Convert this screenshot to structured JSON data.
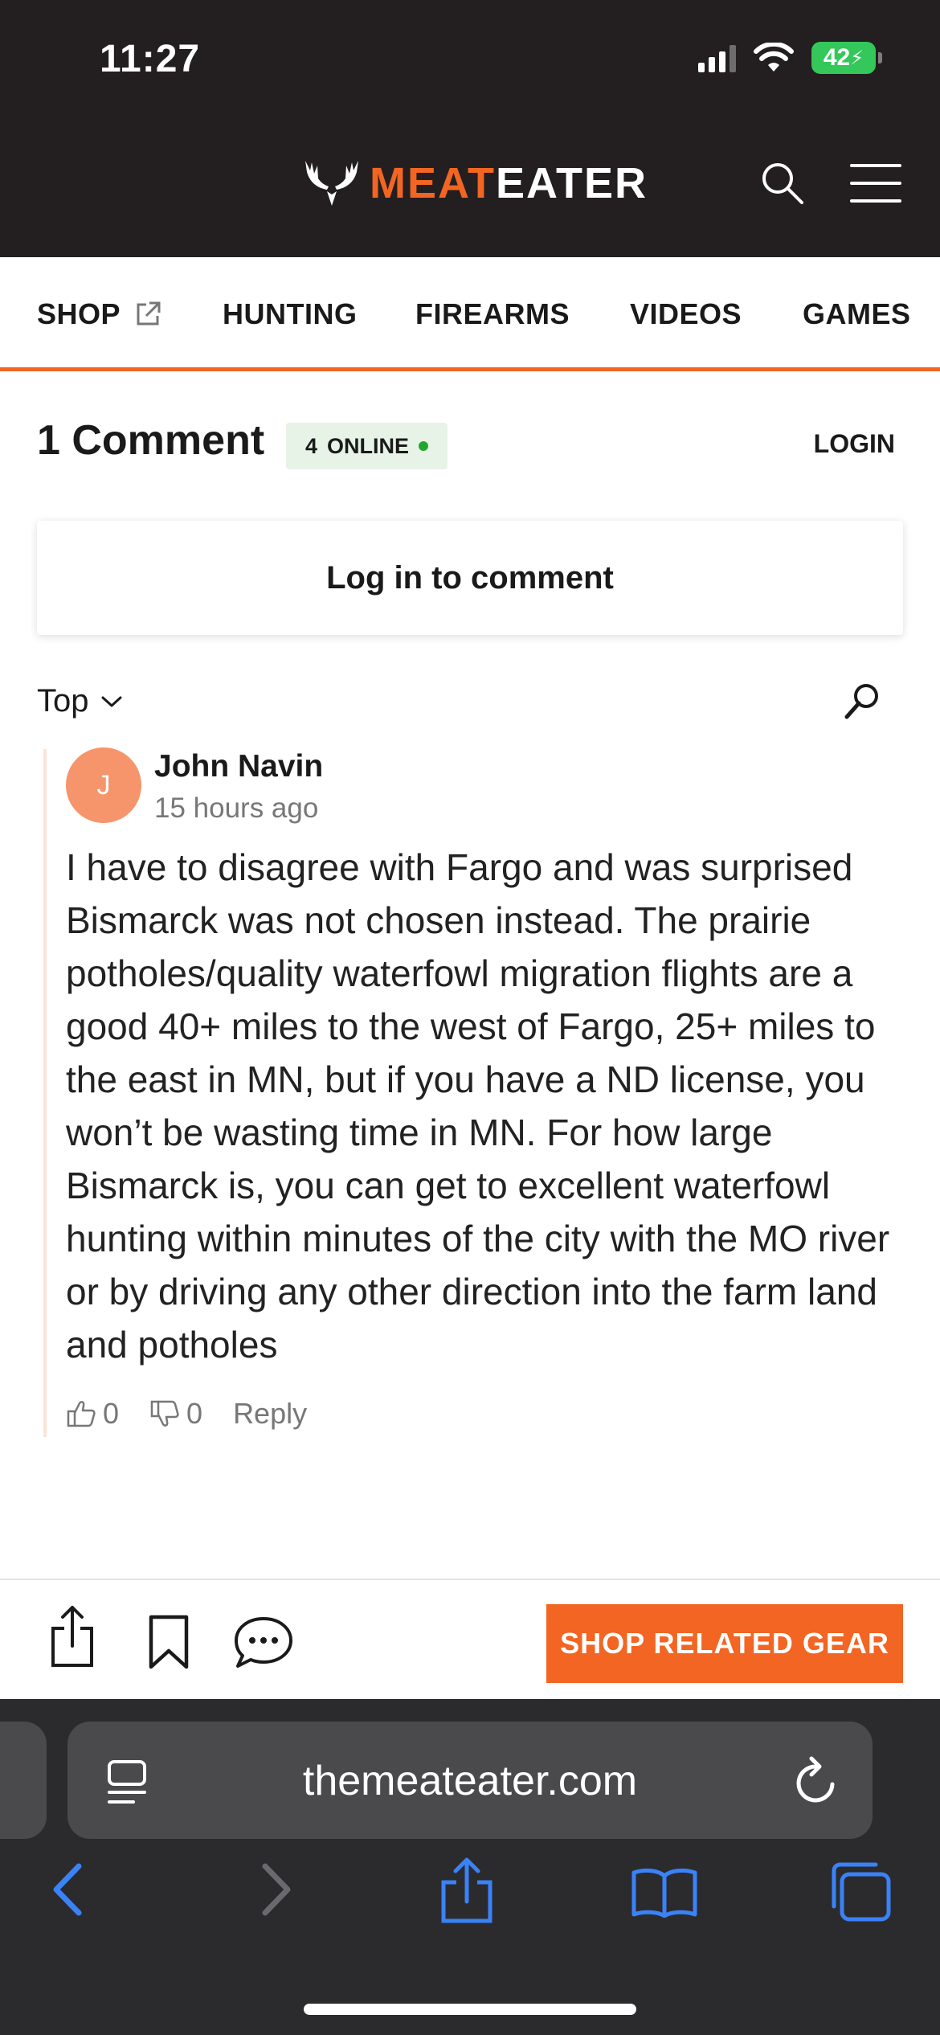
{
  "status_bar": {
    "time": "11:27",
    "battery": "42"
  },
  "header": {
    "brand_part1": "MEAT",
    "brand_part2": "EATER",
    "icons": [
      "antlers-logo-icon",
      "search-icon",
      "hamburger-menu-icon"
    ]
  },
  "nav": {
    "items": [
      {
        "label": "SHOP",
        "icon": "external-link-icon"
      },
      {
        "label": "HUNTING"
      },
      {
        "label": "FIREARMS"
      },
      {
        "label": "VIDEOS"
      },
      {
        "label": "GAMES"
      }
    ]
  },
  "comments_header": {
    "count_label": "1 Comment",
    "online_count": "4",
    "online_label": "ONLINE",
    "login": "LOGIN",
    "login_prompt": "Log in to comment"
  },
  "sort": {
    "label": "Top"
  },
  "comment": {
    "avatar_initial": "J",
    "author": "John Navin",
    "time": "15 hours ago",
    "body": "I have to disagree with Fargo and was surprised Bismarck was not chosen instead. The prairie potholes/quality waterfowl migration flights are a good 40+ miles to the west of Fargo, 25+ miles to the east in MN, but if you have a ND license, you won’t be wasting time in MN. For how large Bismarck is, you can get to excellent waterfowl hunting within minutes of the city with the MO river or by driving any other direction into the farm land and potholes",
    "upvotes": "0",
    "downvotes": "0",
    "reply": "Reply"
  },
  "page_toolbar": {
    "shop_button": "SHOP RELATED GEAR"
  },
  "browser": {
    "url": "themeateater.com"
  },
  "colors": {
    "brand_orange": "#f26522",
    "header_bg": "#231f20",
    "online_green": "#22a72e",
    "safari_blue": "#3a82f7",
    "battery_green": "#34c759"
  }
}
